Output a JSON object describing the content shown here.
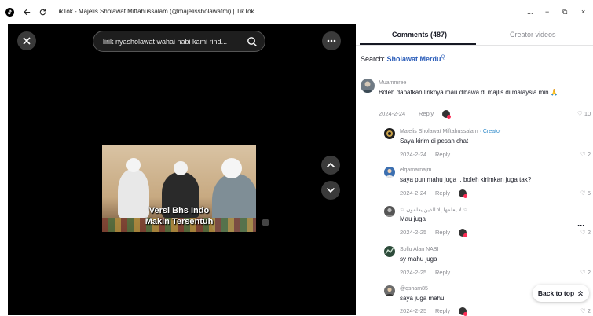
{
  "window": {
    "title": "TikTok - Majelis Sholawat Miftahussalam (@majelissholawatmi) | TikTok",
    "controls": [
      "...",
      "−",
      "⧉",
      "×"
    ]
  },
  "player": {
    "search_query": "lirik nyasholawat wahai nabi kami rind...",
    "caption_line1": "Versi Bhs Indo",
    "caption_line2": "Makin Tersentuh"
  },
  "panel": {
    "tabs": [
      {
        "label": "Comments (487)",
        "active": true
      },
      {
        "label": "Creator videos",
        "active": false
      }
    ],
    "search_label": "Search:",
    "search_term": "Sholawat Merdu",
    "back_to_top": "Back to top"
  },
  "comments": [
    {
      "name": "Muammree",
      "text": "Boleh dapatkan liriknya mau dibawa di majlis di malaysia min 🙏",
      "date": "2024-2-24",
      "reply": "Reply",
      "likes": "10"
    },
    {
      "name": "Majelis Sholawat Miftahussalam",
      "creator_tag": "· Creator",
      "text": "Saya kirim di pesan chat",
      "date": "2024-2-24",
      "reply": "Reply",
      "likes": "2"
    },
    {
      "name": "elqamarnajm",
      "text": "saya pun mahu juga .. boleh kirimkan juga tak?",
      "date": "2024-2-24",
      "reply": "Reply",
      "likes": "5"
    },
    {
      "name": "☆ لا يعلمها إلا الذين يعلمون ☆",
      "text": "Mau juga",
      "date": "2024-2-25",
      "reply": "Reply",
      "likes": "2"
    },
    {
      "name": "Sollu Alan NABI",
      "text": "sy mahu juga",
      "date": "2024-2-25",
      "reply": "Reply",
      "likes": "2"
    },
    {
      "name": "@qsham85",
      "text": "saya juga mahu",
      "date": "2024-2-25",
      "reply": "Reply",
      "likes": "2"
    }
  ],
  "colors": {
    "accent_link": "#2b5db9",
    "creator_tag": "#2f8ac9",
    "brand_red": "#fe2c55"
  }
}
